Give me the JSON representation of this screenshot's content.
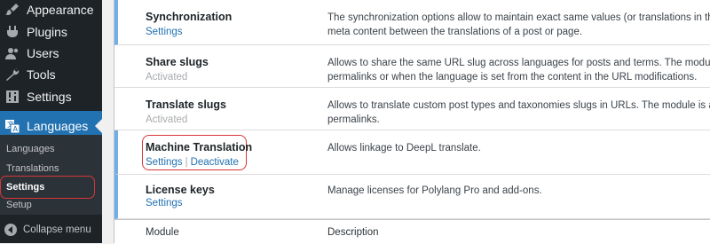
{
  "sidebar": {
    "items": [
      {
        "label": "Appearance",
        "icon": "paintbrush-icon"
      },
      {
        "label": "Plugins",
        "icon": "plugin-icon"
      },
      {
        "label": "Users",
        "icon": "users-icon"
      },
      {
        "label": "Tools",
        "icon": "wrench-icon"
      },
      {
        "label": "Settings",
        "icon": "settings-icon"
      },
      {
        "label": "Languages",
        "icon": "translation-icon"
      }
    ],
    "submenu": [
      "Languages",
      "Translations",
      "Settings",
      "Setup"
    ],
    "collapse_label": "Collapse menu"
  },
  "modules": [
    {
      "name": "Synchronization",
      "action1": "Settings",
      "desc_line1": "The synchronization options allow to maintain exact same values (or translations in the case of taxo",
      "desc_line2": "meta content between the translations of a post or page."
    },
    {
      "name": "Share slugs",
      "status": "Activated",
      "desc_line1": "Allows to share the same URL slug across languages for posts and terms. The module is automatica",
      "desc_line2": "permalinks or when the language is set from the content in the URL modifications."
    },
    {
      "name": "Translate slugs",
      "status": "Activated",
      "desc_line1": "Allows to translate custom post types and taxonomies slugs in URLs. The module is automatically d",
      "desc_line2": "permalinks."
    },
    {
      "name": "Machine Translation",
      "action1": "Settings",
      "separator": "|",
      "action2": "Deactivate",
      "desc_line1": "Allows linkage to DeepL translate.",
      "desc_line2": ""
    },
    {
      "name": "License keys",
      "action1": "Settings",
      "desc_line1": "Manage licenses for Polylang Pro and add-ons.",
      "desc_line2": ""
    }
  ],
  "footer": {
    "col_module": "Module",
    "col_description": "Description"
  },
  "colors": {
    "sidebar_bg": "#1d2327",
    "active_menu": "#2271b1",
    "link": "#2271b1",
    "highlight": "#d63638",
    "row_accent": "#72aee6"
  }
}
